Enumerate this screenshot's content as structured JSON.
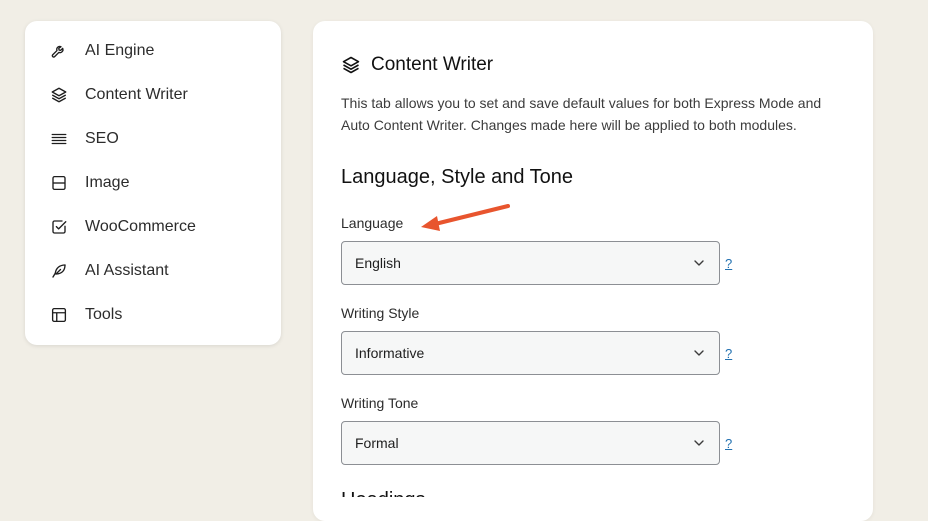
{
  "sidebar": {
    "items": [
      {
        "label": "AI Engine",
        "icon": "wrench-icon"
      },
      {
        "label": "Content Writer",
        "icon": "layers-icon"
      },
      {
        "label": "SEO",
        "icon": "lines-icon"
      },
      {
        "label": "Image",
        "icon": "image-frame-icon"
      },
      {
        "label": "WooCommerce",
        "icon": "checkbox-icon"
      },
      {
        "label": "AI Assistant",
        "icon": "feather-icon"
      },
      {
        "label": "Tools",
        "icon": "layout-icon"
      }
    ]
  },
  "panel": {
    "title": "Content Writer",
    "description": "This tab allows you to set and save default values for both Express Mode and Auto Content Writer. Changes made here will be applied to both modules.",
    "section_title": "Language, Style and Tone",
    "fields": {
      "language": {
        "label": "Language",
        "value": "English",
        "help": "?"
      },
      "writing_style": {
        "label": "Writing Style",
        "value": "Informative",
        "help": "?"
      },
      "writing_tone": {
        "label": "Writing Tone",
        "value": "Formal",
        "help": "?"
      }
    },
    "next_section_partial": "Headings"
  },
  "colors": {
    "background": "#f1eee6",
    "annotation_arrow": "#e8552e",
    "link": "#2271b1"
  }
}
